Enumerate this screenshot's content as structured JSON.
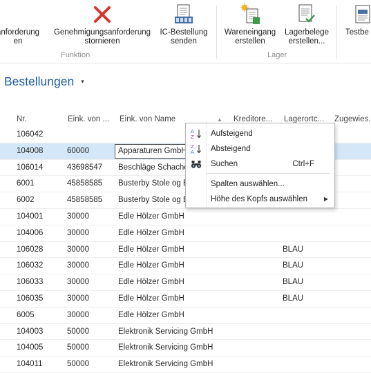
{
  "ribbon": {
    "buttons": [
      {
        "label": "anforderung\nen"
      },
      {
        "label": "Genehmigungsanforderung\nstornieren"
      },
      {
        "label": "IC-Bestellung\nsenden"
      },
      {
        "label": "Wareneingang\nerstellen"
      },
      {
        "label": "Lagerbelege\nerstellen..."
      },
      {
        "label": "Testbe"
      }
    ],
    "groups": {
      "funktion": "Funktion",
      "lager": "Lager"
    }
  },
  "page": {
    "title": "Bestellungen",
    "title_caret": "▾"
  },
  "grid": {
    "headers": {
      "nr": "Nr.",
      "vendor_no": "Eink. von ...",
      "vendor_name": "Eink. von Name",
      "sort_indicator": "▲",
      "creditor": "Kreditore...",
      "location": "Lagerortc...",
      "assigned": "Zugewies..."
    },
    "rows": [
      {
        "nr": "106042",
        "vendor_no": "",
        "vendor_name": "",
        "location": ""
      },
      {
        "nr": "104008",
        "vendor_no": "60000",
        "vendor_name": "Apparaturen GmbH",
        "location": ""
      },
      {
        "nr": "106014",
        "vendor_no": "43698547",
        "vendor_name": "Beschläge Schache",
        "location": ""
      },
      {
        "nr": "6001",
        "vendor_no": "45858585",
        "vendor_name": "Busterby Stole og E",
        "location": ""
      },
      {
        "nr": "6002",
        "vendor_no": "45858585",
        "vendor_name": "Busterby Stole og E",
        "location": ""
      },
      {
        "nr": "104001",
        "vendor_no": "30000",
        "vendor_name": "Edle Hölzer GmbH",
        "location": ""
      },
      {
        "nr": "104006",
        "vendor_no": "30000",
        "vendor_name": "Edle Hölzer GmbH",
        "location": ""
      },
      {
        "nr": "106028",
        "vendor_no": "30000",
        "vendor_name": "Edle Hölzer GmbH",
        "location": "BLAU"
      },
      {
        "nr": "106032",
        "vendor_no": "30000",
        "vendor_name": "Edle Hölzer GmbH",
        "location": "BLAU"
      },
      {
        "nr": "106033",
        "vendor_no": "30000",
        "vendor_name": "Edle Hölzer GmbH",
        "location": "BLAU"
      },
      {
        "nr": "106035",
        "vendor_no": "30000",
        "vendor_name": "Edle Hölzer GmbH",
        "location": "BLAU"
      },
      {
        "nr": "6005",
        "vendor_no": "30000",
        "vendor_name": "Edle Hölzer GmbH",
        "location": ""
      },
      {
        "nr": "104003",
        "vendor_no": "50000",
        "vendor_name": "Elektronik Servicing GmbH",
        "location": ""
      },
      {
        "nr": "104005",
        "vendor_no": "50000",
        "vendor_name": "Elektronik Servicing GmbH",
        "location": ""
      },
      {
        "nr": "104011",
        "vendor_no": "50000",
        "vendor_name": "Elektronik Servicing GmbH",
        "location": ""
      }
    ],
    "selected_row": 1
  },
  "context_menu": {
    "items": [
      {
        "label": "Aufsteigend",
        "icon": "sort-ascending-icon",
        "shortcut": ""
      },
      {
        "label": "Absteigend",
        "icon": "sort-descending-icon",
        "shortcut": ""
      },
      {
        "label": "Suchen",
        "icon": "binoculars-icon",
        "shortcut": "Ctrl+F"
      },
      {
        "label": "Spalten auswählen...",
        "icon": "",
        "shortcut": ""
      },
      {
        "label": "Höhe des Kopfs auswählen",
        "icon": "",
        "shortcut": "",
        "submenu_arrow": "▶"
      }
    ]
  },
  "colors": {
    "accent": "#1f5f9e",
    "selected_row": "#d3e7f8",
    "cancel_red": "#d9352a"
  }
}
